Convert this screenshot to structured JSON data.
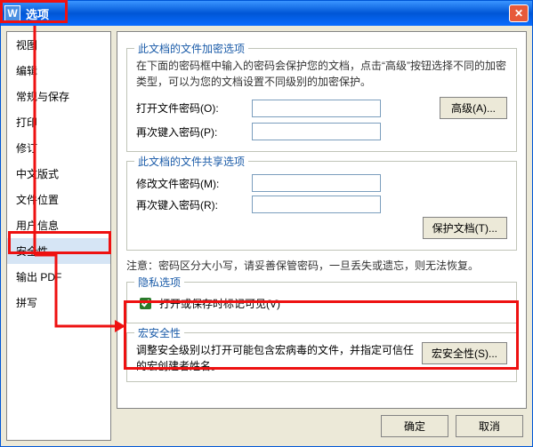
{
  "window": {
    "title": "选项",
    "icon_letter": "W"
  },
  "sidebar": {
    "items": [
      {
        "label": "视图"
      },
      {
        "label": "编辑"
      },
      {
        "label": "常规与保存"
      },
      {
        "label": "打印"
      },
      {
        "label": "修订"
      },
      {
        "label": "中文版式"
      },
      {
        "label": "文件位置"
      },
      {
        "label": "用户信息"
      },
      {
        "label": "安全性"
      },
      {
        "label": "输出 PDF"
      },
      {
        "label": "拼写"
      }
    ],
    "active_index": 8
  },
  "groups": {
    "encrypt": {
      "legend": "此文档的文件加密选项",
      "desc": "在下面的密码框中输入的密码会保护您的文档，点击“高级”按钮选择不同的加密类型，可以为您的文档设置不同级别的加密保护。",
      "open_label": "打开文件密码(O):",
      "reenter_label": "再次键入密码(P):",
      "advanced_btn": "高级(A)..."
    },
    "share": {
      "legend": "此文档的文件共享选项",
      "modify_label": "修改文件密码(M):",
      "reenter_label": "再次键入密码(R):",
      "protect_btn": "保护文档(T)..."
    },
    "note": "注意：密码区分大小写，请妥善保管密码，一旦丢失或遗忘，则无法恢复。",
    "privacy": {
      "legend": "隐私选项",
      "checkbox_label": "打开或保存时标记可见(V)",
      "checked": true
    },
    "macro": {
      "legend": "宏安全性",
      "desc": "调整安全级别以打开可能包含宏病毒的文件，并指定可信任的宏创建者姓名。",
      "btn": "宏安全性(S)..."
    }
  },
  "buttons": {
    "ok": "确定",
    "cancel": "取消"
  }
}
